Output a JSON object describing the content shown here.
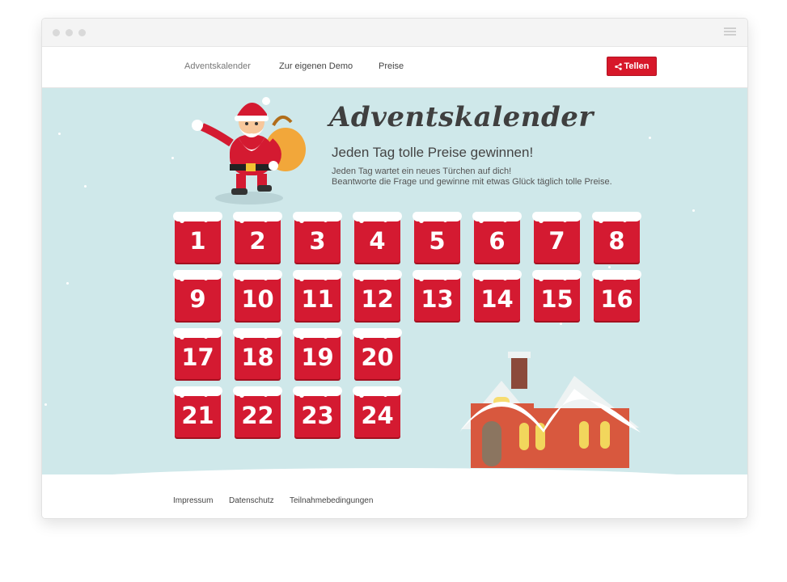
{
  "nav": {
    "items": [
      {
        "label": "Adventskalender"
      },
      {
        "label": "Zur eigenen Demo"
      },
      {
        "label": "Preise"
      }
    ],
    "share_label": "Tellen"
  },
  "hero": {
    "title": "Adventskalender",
    "subtitle": "Jeden Tag tolle Preise gewinnen!",
    "line1": "Jeden Tag wartet ein neues Türchen auf dich!",
    "line2": "Beantworte die Frage und gewinne mit etwas Glück täglich tolle Preise."
  },
  "doors": [
    "1",
    "2",
    "3",
    "4",
    "5",
    "6",
    "7",
    "8",
    "9",
    "10",
    "11",
    "12",
    "13",
    "14",
    "15",
    "16",
    "17",
    "18",
    "19",
    "20",
    "21",
    "22",
    "23",
    "24"
  ],
  "footer": {
    "links": [
      {
        "label": "Impressum"
      },
      {
        "label": "Datenschutz"
      },
      {
        "label": "Teilnahmebedingungen"
      }
    ]
  },
  "colors": {
    "accent": "#d41a31",
    "hero_bg": "#cfe8ea"
  },
  "icons": [
    "share-icon",
    "hamburger-icon",
    "santa-illustration",
    "house-illustration"
  ]
}
